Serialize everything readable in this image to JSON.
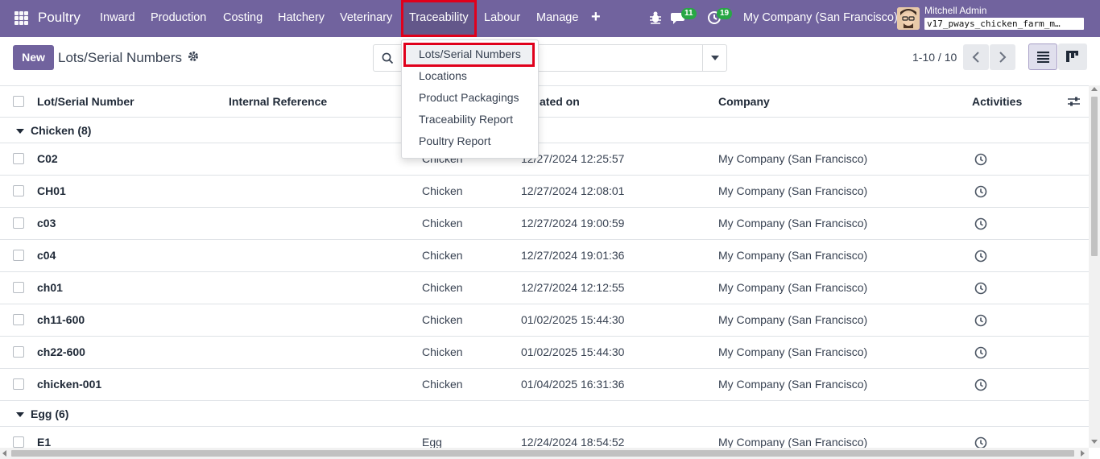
{
  "navbar": {
    "brand": "Poultry",
    "menu": [
      "Inward",
      "Production",
      "Costing",
      "Hatchery",
      "Veterinary",
      "Traceability",
      "Labour",
      "Manage"
    ],
    "messages_count": "11",
    "activities_count": "19",
    "company": "My Company (San Francisco)",
    "user_name": "Mitchell Admin",
    "database": "v17_pways_chicken_farm_m…"
  },
  "control_panel": {
    "new_label": "New",
    "breadcrumb": "Lots/Serial Numbers",
    "pager": "1-10 / 10"
  },
  "dropdown": {
    "items": [
      "Lots/Serial Numbers",
      "Locations",
      "Product Packagings",
      "Traceability Report",
      "Poultry Report"
    ]
  },
  "table": {
    "headers": {
      "lot": "Lot/Serial Number",
      "internal_ref": "Internal Reference",
      "created": "ated on",
      "company": "Company",
      "activities": "Activities"
    },
    "groups": [
      {
        "label": "Chicken (8)"
      },
      {
        "label": "Egg (6)"
      }
    ],
    "rows": [
      {
        "lot": "C02",
        "product": "Chicken",
        "created": "12/27/2024 12:25:57",
        "company": "My Company (San Francisco)"
      },
      {
        "lot": "CH01",
        "product": "Chicken",
        "created": "12/27/2024 12:08:01",
        "company": "My Company (San Francisco)"
      },
      {
        "lot": "c03",
        "product": "Chicken",
        "created": "12/27/2024 19:00:59",
        "company": "My Company (San Francisco)"
      },
      {
        "lot": "c04",
        "product": "Chicken",
        "created": "12/27/2024 19:01:36",
        "company": "My Company (San Francisco)"
      },
      {
        "lot": "ch01",
        "product": "Chicken",
        "created": "12/27/2024 12:12:55",
        "company": "My Company (San Francisco)"
      },
      {
        "lot": "ch11-600",
        "product": "Chicken",
        "created": "01/02/2025 15:44:30",
        "company": "My Company (San Francisco)"
      },
      {
        "lot": "ch22-600",
        "product": "Chicken",
        "created": "01/02/2025 15:44:30",
        "company": "My Company (San Francisco)"
      },
      {
        "lot": "chicken-001",
        "product": "Chicken",
        "created": "01/04/2025 16:31:36",
        "company": "My Company (San Francisco)"
      },
      {
        "lot": "E1",
        "product": "Egg",
        "created": "12/24/2024 18:54:52",
        "company": "My Company (San Francisco)"
      }
    ]
  },
  "colors": {
    "navbar": "#71639e",
    "highlight": "#e0001b",
    "badge": "#28a745"
  }
}
